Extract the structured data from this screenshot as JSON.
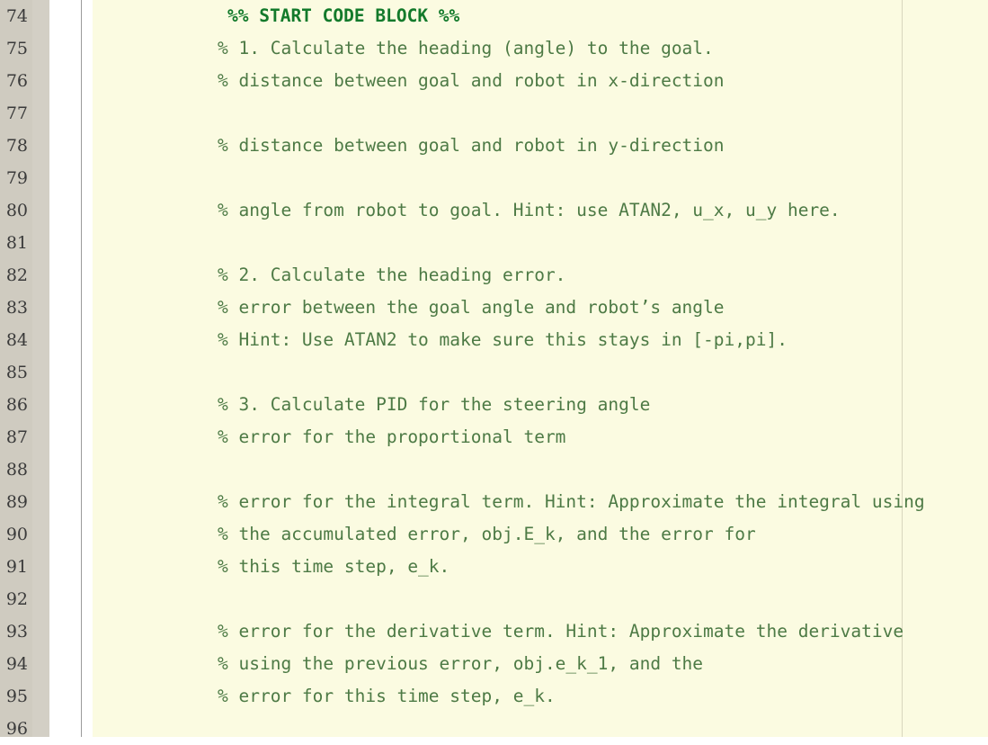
{
  "editor": {
    "app": "MATLAB Editor",
    "language": "MATLAB",
    "first_line_number": 74,
    "last_line_number": 96,
    "column_ruler": 80,
    "colors": {
      "code_background": "#fbfbe1",
      "gutter_background": "#cfcbc0",
      "gutter_number_text": "#3a3a3a",
      "comment_text": "#4d7a45",
      "section_comment_text": "#137a2b",
      "ruler_line": "#d8d6bd",
      "separator_line": "#9b9b9b"
    }
  },
  "lines": [
    {
      "number": "74",
      "text": "%% START CODE BLOCK %%",
      "style": "section"
    },
    {
      "number": "75",
      "text": "% 1. Calculate the heading (angle) to the goal.",
      "style": "comment"
    },
    {
      "number": "76",
      "text": "% distance between goal and robot in x-direction",
      "style": "comment"
    },
    {
      "number": "77",
      "text": "",
      "style": "blank"
    },
    {
      "number": "78",
      "text": "% distance between goal and robot in y-direction",
      "style": "comment"
    },
    {
      "number": "79",
      "text": "",
      "style": "blank"
    },
    {
      "number": "80",
      "text": "% angle from robot to goal. Hint: use ATAN2, u_x, u_y here.",
      "style": "comment"
    },
    {
      "number": "81",
      "text": "",
      "style": "blank"
    },
    {
      "number": "82",
      "text": "% 2. Calculate the heading error.",
      "style": "comment"
    },
    {
      "number": "83",
      "text": "% error between the goal angle and robot’s angle",
      "style": "comment"
    },
    {
      "number": "84",
      "text": "% Hint: Use ATAN2 to make sure this stays in [-pi,pi].",
      "style": "comment"
    },
    {
      "number": "85",
      "text": "",
      "style": "blank"
    },
    {
      "number": "86",
      "text": "% 3. Calculate PID for the steering angle",
      "style": "comment"
    },
    {
      "number": "87",
      "text": "% error for the proportional term",
      "style": "comment"
    },
    {
      "number": "88",
      "text": "",
      "style": "blank"
    },
    {
      "number": "89",
      "text": "% error for the integral term. Hint: Approximate the integral using",
      "style": "comment"
    },
    {
      "number": "90",
      "text": "% the accumulated error, obj.E_k, and the error for",
      "style": "comment"
    },
    {
      "number": "91",
      "text": "% this time step, e_k.",
      "style": "comment"
    },
    {
      "number": "92",
      "text": "",
      "style": "blank"
    },
    {
      "number": "93",
      "text": "% error for the derivative term. Hint: Approximate the derivative",
      "style": "comment"
    },
    {
      "number": "94",
      "text": "% using the previous error, obj.e_k_1, and the",
      "style": "comment"
    },
    {
      "number": "95",
      "text": "% error for this time step, e_k.",
      "style": "comment"
    },
    {
      "number": "96",
      "text": "",
      "style": "blank"
    }
  ]
}
